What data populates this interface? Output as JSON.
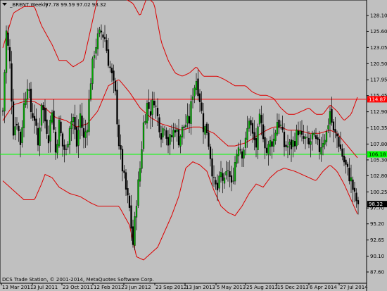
{
  "header": {
    "symbol": "_BRENT,Weekly",
    "ohlc": "97.78 99.59 97.02 98.32"
  },
  "footer": {
    "copyright": "DCS Trade Station, © 2001-2014, MetaQuotes Software Corp."
  },
  "colors": {
    "background": "#c0c0c0",
    "bull_candle": "#00aa00",
    "bear_candle": "#000000",
    "bands": "#dd0000",
    "resistance_line": "#ff0000",
    "support_line": "#00ff00",
    "price_badge": "#000000"
  },
  "chart_data": {
    "type": "candlestick",
    "title": "",
    "symbol": "_BRENT",
    "timeframe": "Weekly",
    "last_price": "98.32",
    "ylim": [
      86.5,
      130.0
    ],
    "grid": false,
    "y_ticks": [
      "128.10",
      "125.60",
      "123.05",
      "120.50",
      "117.95",
      "115.45",
      "112.90",
      "110.35",
      "107.80",
      "105.30",
      "102.80",
      "100.25",
      "97.70",
      "95.20",
      "92.65",
      "90.10",
      "87.60"
    ],
    "x_ticks": [
      "13 Mar 2011",
      "3 Jul 2011",
      "23 Oct 2011",
      "12 Feb 2012",
      "3 Jun 2012",
      "23 Sep 2012",
      "13 Jan 2013",
      "5 May 2013",
      "25 Aug 2013",
      "15 Dec 2013",
      "6 Apr 2014",
      "27 Jul 2014"
    ],
    "horizontal_lines": [
      {
        "label": "114.87",
        "value": 114.87,
        "color": "#ff0000"
      },
      {
        "label": "106.18",
        "value": 106.18,
        "color": "#00ff00"
      }
    ],
    "price_marker": {
      "label": "98.32",
      "value": 98.32
    },
    "close_path": [
      [
        0,
        113.0
      ],
      [
        5,
        125.5
      ],
      [
        10,
        120.5
      ],
      [
        15,
        110.0
      ],
      [
        20,
        111.5
      ],
      [
        25,
        108.0
      ],
      [
        30,
        114.0
      ],
      [
        35,
        117.5
      ],
      [
        40,
        113.0
      ],
      [
        45,
        112.0
      ],
      [
        50,
        107.5
      ],
      [
        55,
        114.5
      ],
      [
        60,
        111.5
      ],
      [
        65,
        109.0
      ],
      [
        70,
        113.5
      ],
      [
        75,
        106.5
      ],
      [
        80,
        111.0
      ],
      [
        85,
        107.5
      ],
      [
        90,
        106.5
      ],
      [
        95,
        111.0
      ],
      [
        100,
        112.0
      ],
      [
        105,
        107.5
      ],
      [
        110,
        112.5
      ],
      [
        115,
        108.5
      ],
      [
        120,
        111.0
      ],
      [
        125,
        118.0
      ],
      [
        130,
        122.5
      ],
      [
        135,
        124.5
      ],
      [
        140,
        125.5
      ],
      [
        145,
        124.5
      ],
      [
        150,
        121.0
      ],
      [
        155,
        118.5
      ],
      [
        160,
        115.5
      ],
      [
        165,
        108.0
      ],
      [
        170,
        104.0
      ],
      [
        175,
        100.5
      ],
      [
        180,
        97.5
      ],
      [
        185,
        92.0
      ],
      [
        190,
        99.0
      ],
      [
        195,
        104.0
      ],
      [
        200,
        111.0
      ],
      [
        205,
        114.0
      ],
      [
        210,
        113.0
      ],
      [
        215,
        115.0
      ],
      [
        220,
        112.0
      ],
      [
        225,
        109.5
      ],
      [
        230,
        111.0
      ],
      [
        235,
        108.0
      ],
      [
        240,
        109.0
      ],
      [
        245,
        110.5
      ],
      [
        250,
        108.5
      ],
      [
        255,
        110.0
      ],
      [
        260,
        111.0
      ],
      [
        265,
        111.5
      ],
      [
        270,
        116.0
      ],
      [
        275,
        118.0
      ],
      [
        280,
        115.0
      ],
      [
        285,
        110.5
      ],
      [
        290,
        110.0
      ],
      [
        295,
        106.0
      ],
      [
        300,
        101.5
      ],
      [
        305,
        100.5
      ],
      [
        310,
        103.0
      ],
      [
        315,
        101.5
      ],
      [
        320,
        104.0
      ],
      [
        325,
        101.0
      ],
      [
        330,
        105.0
      ],
      [
        335,
        108.0
      ],
      [
        340,
        106.5
      ],
      [
        345,
        108.0
      ],
      [
        350,
        112.0
      ],
      [
        355,
        109.0
      ],
      [
        360,
        107.5
      ],
      [
        365,
        111.5
      ],
      [
        370,
        109.5
      ],
      [
        375,
        106.5
      ],
      [
        380,
        108.0
      ],
      [
        385,
        108.5
      ],
      [
        390,
        111.5
      ],
      [
        395,
        110.5
      ],
      [
        400,
        107.5
      ],
      [
        405,
        107.5
      ],
      [
        410,
        107.5
      ],
      [
        415,
        108.5
      ],
      [
        420,
        110.0
      ],
      [
        425,
        108.5
      ],
      [
        430,
        108.5
      ],
      [
        435,
        107.5
      ],
      [
        440,
        109.0
      ],
      [
        445,
        108.0
      ],
      [
        450,
        107.0
      ],
      [
        455,
        108.5
      ],
      [
        460,
        109.5
      ],
      [
        465,
        113.0
      ],
      [
        470,
        109.5
      ],
      [
        475,
        109.0
      ],
      [
        480,
        107.0
      ],
      [
        485,
        105.0
      ],
      [
        490,
        103.5
      ],
      [
        495,
        102.0
      ],
      [
        500,
        99.5
      ],
      [
        505,
        98.32
      ]
    ],
    "bollinger": {
      "upper": [
        [
          0,
          123.0
        ],
        [
          15,
          128.5
        ],
        [
          30,
          129.5
        ],
        [
          45,
          129.5
        ],
        [
          55,
          126.5
        ],
        [
          60,
          125.5
        ],
        [
          70,
          123.5
        ],
        [
          80,
          121.0
        ],
        [
          90,
          121.0
        ],
        [
          100,
          120.0
        ],
        [
          115,
          121.0
        ],
        [
          125,
          126.0
        ],
        [
          135,
          131.0
        ],
        [
          150,
          131.5
        ],
        [
          170,
          131.0
        ],
        [
          185,
          130.0
        ],
        [
          195,
          128.0
        ],
        [
          205,
          131.0
        ],
        [
          215,
          130.0
        ],
        [
          225,
          124.0
        ],
        [
          235,
          121.0
        ],
        [
          245,
          119.0
        ],
        [
          255,
          118.5
        ],
        [
          265,
          119.0
        ],
        [
          275,
          120.0
        ],
        [
          285,
          118.5
        ],
        [
          295,
          118.5
        ],
        [
          305,
          118.5
        ],
        [
          315,
          118.0
        ],
        [
          330,
          117.0
        ],
        [
          345,
          117.0
        ],
        [
          355,
          116.0
        ],
        [
          365,
          115.5
        ],
        [
          375,
          115.5
        ],
        [
          385,
          115.0
        ],
        [
          395,
          113.5
        ],
        [
          405,
          112.5
        ],
        [
          415,
          112.5
        ],
        [
          425,
          113.0
        ],
        [
          435,
          113.5
        ],
        [
          445,
          112.5
        ],
        [
          455,
          112.5
        ],
        [
          465,
          114.0
        ],
        [
          475,
          113.0
        ],
        [
          485,
          111.5
        ],
        [
          495,
          112.5
        ],
        [
          505,
          115.5
        ]
      ],
      "middle": [
        [
          0,
          111.5
        ],
        [
          15,
          114.0
        ],
        [
          30,
          114.5
        ],
        [
          45,
          114.5
        ],
        [
          60,
          113.5
        ],
        [
          75,
          112.0
        ],
        [
          90,
          111.5
        ],
        [
          105,
          110.5
        ],
        [
          120,
          111.0
        ],
        [
          135,
          113.0
        ],
        [
          150,
          117.0
        ],
        [
          165,
          118.0
        ],
        [
          180,
          116.0
        ],
        [
          195,
          113.5
        ],
        [
          210,
          112.0
        ],
        [
          225,
          111.0
        ],
        [
          240,
          110.5
        ],
        [
          255,
          110.0
        ],
        [
          270,
          110.5
        ],
        [
          280,
          110.5
        ],
        [
          290,
          110.0
        ],
        [
          300,
          109.5
        ],
        [
          310,
          108.5
        ],
        [
          320,
          107.5
        ],
        [
          330,
          107.5
        ],
        [
          345,
          108.0
        ],
        [
          360,
          109.0
        ],
        [
          375,
          110.0
        ],
        [
          385,
          110.5
        ],
        [
          395,
          110.5
        ],
        [
          405,
          110.0
        ],
        [
          420,
          110.0
        ],
        [
          435,
          109.5
        ],
        [
          450,
          109.5
        ],
        [
          465,
          110.0
        ],
        [
          475,
          109.5
        ],
        [
          490,
          107.5
        ],
        [
          505,
          105.5
        ]
      ],
      "lower": [
        [
          0,
          102.0
        ],
        [
          15,
          100.5
        ],
        [
          30,
          99.0
        ],
        [
          45,
          99.0
        ],
        [
          55,
          101.5
        ],
        [
          60,
          103.0
        ],
        [
          70,
          102.5
        ],
        [
          80,
          101.0
        ],
        [
          95,
          100.0
        ],
        [
          110,
          99.5
        ],
        [
          125,
          98.5
        ],
        [
          135,
          98.0
        ],
        [
          150,
          98.0
        ],
        [
          165,
          98.0
        ],
        [
          180,
          95.0
        ],
        [
          190,
          90.0
        ],
        [
          200,
          89.5
        ],
        [
          210,
          90.5
        ],
        [
          220,
          91.5
        ],
        [
          230,
          94.0
        ],
        [
          240,
          96.5
        ],
        [
          250,
          99.5
        ],
        [
          260,
          104.0
        ],
        [
          270,
          105.0
        ],
        [
          280,
          104.5
        ],
        [
          290,
          103.5
        ],
        [
          300,
          100.5
        ],
        [
          310,
          98.0
        ],
        [
          320,
          97.0
        ],
        [
          330,
          96.5
        ],
        [
          340,
          98.0
        ],
        [
          350,
          100.0
        ],
        [
          360,
          101.5
        ],
        [
          370,
          101.0
        ],
        [
          380,
          102.5
        ],
        [
          390,
          103.5
        ],
        [
          400,
          104.0
        ],
        [
          415,
          103.5
        ],
        [
          425,
          103.0
        ],
        [
          435,
          102.5
        ],
        [
          445,
          102.0
        ],
        [
          455,
          103.5
        ],
        [
          465,
          104.5
        ],
        [
          475,
          103.5
        ],
        [
          485,
          101.5
        ],
        [
          495,
          99.0
        ],
        [
          505,
          96.5
        ]
      ]
    }
  }
}
